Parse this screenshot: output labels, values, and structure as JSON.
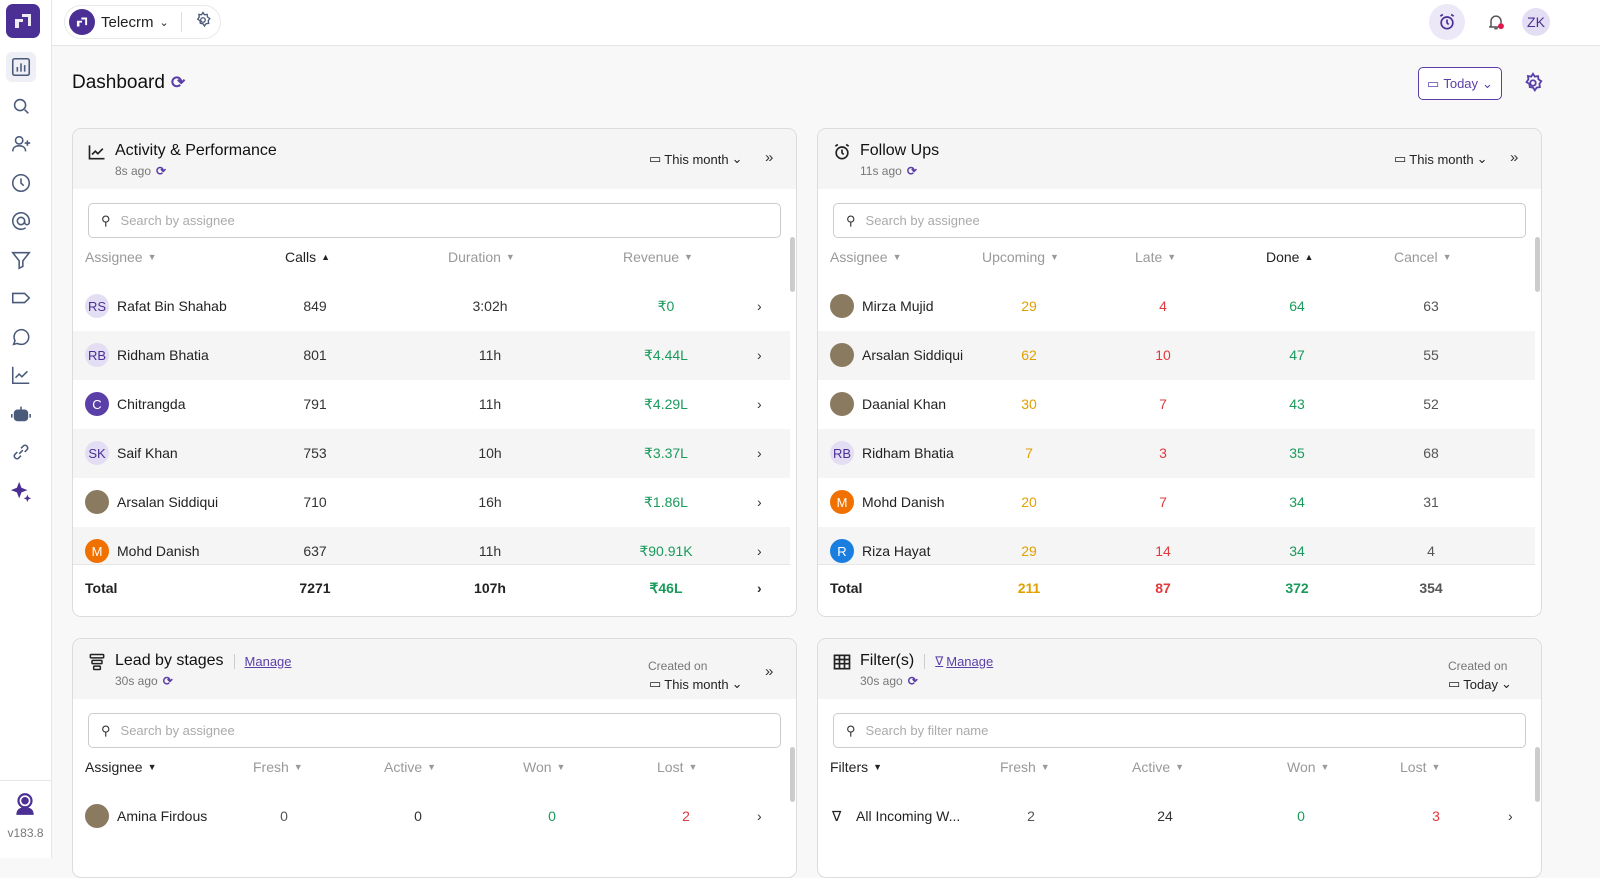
{
  "colors": {
    "brand": "#4b2f94",
    "accent": "#5b3fa8",
    "green": "#1a9a5c",
    "orange": "#e0a000",
    "red": "#e0393e"
  },
  "sidebar": {
    "items": [
      {
        "icon": "bar-chart-icon",
        "active": true
      },
      {
        "icon": "search-icon"
      },
      {
        "icon": "add-user-icon"
      },
      {
        "icon": "clock-icon"
      },
      {
        "icon": "at-sign-icon"
      },
      {
        "icon": "filter-icon"
      },
      {
        "icon": "tag-icon"
      },
      {
        "icon": "whatsapp-icon"
      },
      {
        "icon": "trend-chart-icon"
      },
      {
        "icon": "robot-icon"
      },
      {
        "icon": "link-icon"
      },
      {
        "icon": "sparkle-icon"
      }
    ],
    "version": "v183.8"
  },
  "topbar": {
    "workspace": "Telecrm",
    "avatar": "ZK"
  },
  "page": {
    "title": "Dashboard",
    "date_filter": "Today"
  },
  "activity": {
    "title": "Activity & Performance",
    "ago": "8s ago",
    "period": "This month",
    "search_placeholder": "Search by assignee",
    "columns": [
      "Assignee",
      "Calls",
      "Duration",
      "Revenue"
    ],
    "rows": [
      {
        "initials": "RS",
        "name": "Rafat Bin Shahab",
        "calls": "849",
        "duration": "3:02h",
        "revenue": "₹0"
      },
      {
        "initials": "RB",
        "name": "Ridham Bhatia",
        "calls": "801",
        "duration": "11h",
        "revenue": "₹4.44L"
      },
      {
        "initials": "C",
        "name": "Chitrangda",
        "calls": "791",
        "duration": "11h",
        "revenue": "₹4.29L"
      },
      {
        "initials": "SK",
        "name": "Saif Khan",
        "calls": "753",
        "duration": "10h",
        "revenue": "₹3.37L"
      },
      {
        "initials": "",
        "name": "Arsalan Siddiqui",
        "calls": "710",
        "duration": "16h",
        "revenue": "₹1.86L"
      },
      {
        "initials": "M",
        "name": "Mohd Danish",
        "calls": "637",
        "duration": "11h",
        "revenue": "₹90.91K"
      }
    ],
    "total": {
      "label": "Total",
      "calls": "7271",
      "duration": "107h",
      "revenue": "₹46L"
    }
  },
  "followups": {
    "title": "Follow Ups",
    "ago": "11s ago",
    "period": "This month",
    "search_placeholder": "Search by assignee",
    "columns": [
      "Assignee",
      "Upcoming",
      "Late",
      "Done",
      "Cancel"
    ],
    "rows": [
      {
        "initials": "",
        "name": "Mirza Mujid",
        "upcoming": "29",
        "late": "4",
        "done": "64",
        "cancel": "63"
      },
      {
        "initials": "",
        "name": "Arsalan Siddiqui",
        "upcoming": "62",
        "late": "10",
        "done": "47",
        "cancel": "55"
      },
      {
        "initials": "",
        "name": "Daanial Khan",
        "upcoming": "30",
        "late": "7",
        "done": "43",
        "cancel": "52"
      },
      {
        "initials": "RB",
        "name": "Ridham Bhatia",
        "upcoming": "7",
        "late": "3",
        "done": "35",
        "cancel": "68"
      },
      {
        "initials": "M",
        "name": "Mohd Danish",
        "upcoming": "20",
        "late": "7",
        "done": "34",
        "cancel": "31"
      },
      {
        "initials": "R",
        "name": "Riza Hayat",
        "upcoming": "29",
        "late": "14",
        "done": "34",
        "cancel": "4"
      }
    ],
    "total": {
      "label": "Total",
      "upcoming": "211",
      "late": "87",
      "done": "372",
      "cancel": "354"
    }
  },
  "leads": {
    "title": "Lead by stages",
    "manage": "Manage",
    "ago": "30s ago",
    "created_label": "Created on",
    "period": "This month",
    "search_placeholder": "Search by assignee",
    "columns": [
      "Assignee",
      "Fresh",
      "Active",
      "Won",
      "Lost"
    ],
    "rows": [
      {
        "initials": "",
        "name": "Amina Firdous",
        "fresh": "0",
        "active": "0",
        "won": "0",
        "lost": "2"
      }
    ]
  },
  "filters": {
    "title": "Filter(s)",
    "manage": "Manage",
    "ago": "30s ago",
    "created_label": "Created on",
    "period": "Today",
    "search_placeholder": "Search by filter name",
    "columns": [
      "Filters",
      "Fresh",
      "Active",
      "Won",
      "Lost"
    ],
    "rows": [
      {
        "name": "All Incoming W...",
        "fresh": "2",
        "active": "24",
        "won": "0",
        "lost": "3"
      }
    ]
  }
}
